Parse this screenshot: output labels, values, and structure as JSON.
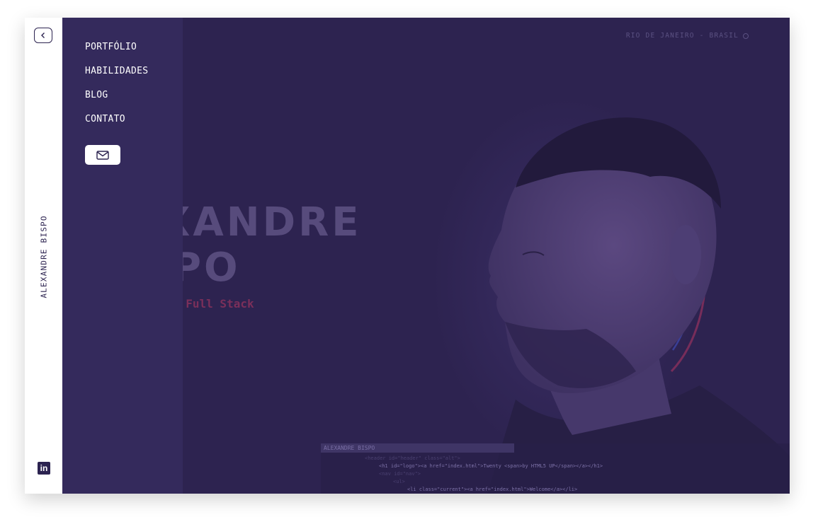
{
  "sidebar": {
    "back_label": "back",
    "vertical_name": "ALEXANDRE BISPO",
    "linkedin_label": "in"
  },
  "menu": {
    "items": [
      {
        "label": "PORTFÓLIO"
      },
      {
        "label": "HABILIDADES"
      },
      {
        "label": "BLOG"
      },
      {
        "label": "CONTATO"
      }
    ]
  },
  "hero": {
    "name_line1": "EXANDRE",
    "name_line2": "PO",
    "role": "r Full Stack",
    "location": "RIO DE JANEIRO - BRASIL"
  },
  "code": {
    "title": "ALEXANDRE BISPO",
    "lines": [
      "<header id=\"header\" class=\"alt\">",
      "<h1 id=\"logo\"><a href=\"index.html\">Twenty <span>by HTML5 UP</span></a></h1>",
      "<nav id=\"nav\">",
      "<ul>",
      "<li class=\"current\"><a href=\"index.html\">Welcome</a></li>"
    ]
  },
  "colors": {
    "background": "#2d2350",
    "menu_panel": "#342a5c",
    "accent_red": "#7b2f5a",
    "accent_blue": "#3a3f9a"
  }
}
